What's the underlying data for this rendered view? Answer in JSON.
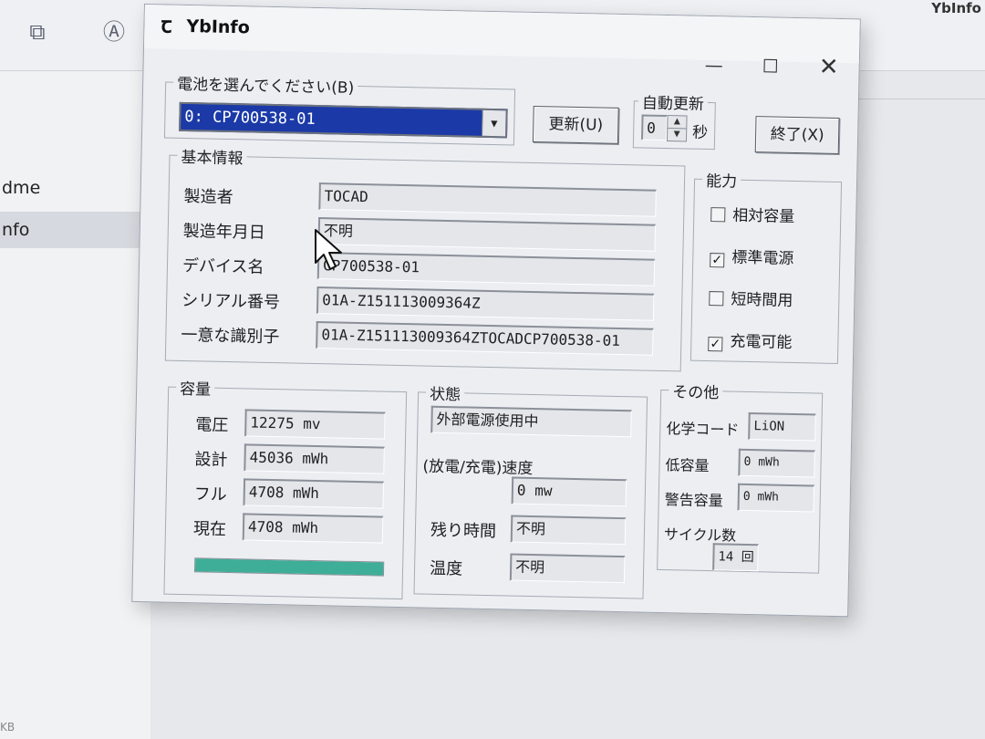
{
  "background": {
    "sidebar": [
      {
        "label": "dme"
      },
      {
        "label": "nfo"
      }
    ],
    "top_right_title": "YbInfo",
    "bottom_text": "KB"
  },
  "window": {
    "title": "YbInfo",
    "minimize": "—",
    "maximize": "☐",
    "close": "✕"
  },
  "battery_select": {
    "label": "電池を選んでください(B)",
    "selected": "0: CP700538-01",
    "refresh_button": "更新(U)"
  },
  "auto_update": {
    "label": "自動更新",
    "value": "0",
    "unit": "秒"
  },
  "exit_button": "終了(X)",
  "basic_info": {
    "label": "基本情報",
    "rows": [
      {
        "label": "製造者",
        "value": "TOCAD"
      },
      {
        "label": "製造年月日",
        "value": "不明"
      },
      {
        "label": "デバイス名",
        "value": "CP700538-01"
      },
      {
        "label": "シリアル番号",
        "value": "01A-Z151113009364Z"
      },
      {
        "label": "一意な識別子",
        "value": "01A-Z151113009364ZTOCADCP700538-01"
      }
    ]
  },
  "capability": {
    "label": "能力",
    "items": [
      {
        "label": "相対容量",
        "checked": false
      },
      {
        "label": "標準電源",
        "checked": true
      },
      {
        "label": "短時間用",
        "checked": false
      },
      {
        "label": "充電可能",
        "checked": true
      }
    ]
  },
  "capacity": {
    "label": "容量",
    "rows": [
      {
        "label": "電圧",
        "value": "12275 mv"
      },
      {
        "label": "設計",
        "value": "45036 mWh"
      },
      {
        "label": "フル",
        "value": "4708 mWh"
      },
      {
        "label": "現在",
        "value": "4708 mWh"
      }
    ],
    "charge_level_percent": 100,
    "bar_color": "#3fae98"
  },
  "status": {
    "label": "状態",
    "state": "外部電源使用中",
    "rate_label": "(放電/充電)速度",
    "rate_value": "0 mw",
    "remaining_label": "残り時間",
    "remaining_value": "不明",
    "temp_label": "温度",
    "temp_value": "不明"
  },
  "other": {
    "label": "その他",
    "chem_label": "化学コード",
    "chem_value": "LiON",
    "low_label": "低容量",
    "low_value": "0 mWh",
    "warn_label": "警告容量",
    "warn_value": "0 mWh",
    "cycle_label": "サイクル数",
    "cycle_value": "14 回"
  },
  "colors": {
    "selection": "#1b3aa8",
    "dialog_bg": "#eceef2"
  }
}
